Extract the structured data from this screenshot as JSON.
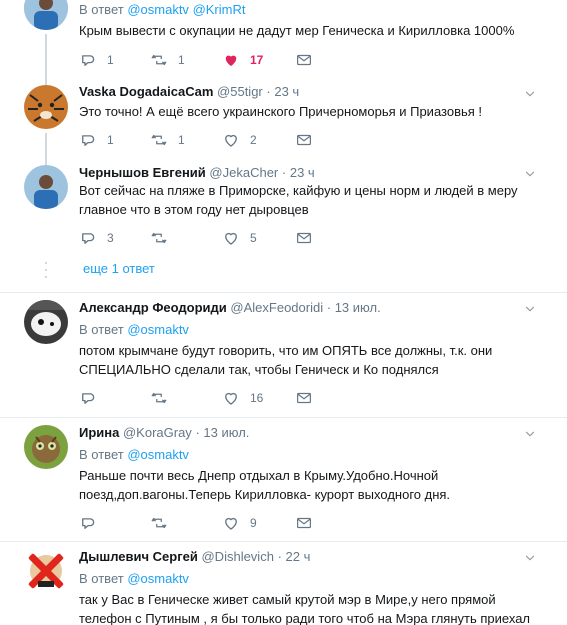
{
  "tweets": [
    {
      "reply_prefix": "В ответ",
      "mentions": [
        "@osmaktv",
        "@KrimRt"
      ],
      "text": "Крым вывести с окупации не дадут мер Геническа и Кирилловка 1000%",
      "replies": "1",
      "retweets": "1",
      "likes": "17",
      "liked": true
    },
    {
      "name": "Vaska DogadaicaCam",
      "handle": "@55tigr",
      "time": "23 ч",
      "text": "Это точно! А ещё всего украинского Причерноморья и Приазовья !",
      "replies": "1",
      "retweets": "1",
      "likes": "2"
    },
    {
      "name": "Чернышов Евгений",
      "handle": "@JekaCher",
      "time": "23 ч",
      "text_line1": "Вот сейчас на пляже в Приморске, кайфую и цены норм и людей в меру",
      "text_line2": "главное что в этом году нет дыровцев",
      "replies": "3",
      "retweets": "",
      "likes": "5"
    },
    {
      "more_replies": "еще 1 ответ"
    },
    {
      "name": "Александр Феодориди",
      "handle": "@AlexFeodoridi",
      "time": "13 июл.",
      "reply_prefix": "В ответ",
      "mention": "@osmaktv",
      "text_line1": "потом крымчане будут говорить, что им ОПЯТЬ все должны, т.к. они",
      "text_line2": "СПЕЦИАЛЬНО сделали так, чтобы Геническ и Ко поднялся",
      "replies": "",
      "retweets": "",
      "likes": "16"
    },
    {
      "name": "Ирина",
      "handle": "@KoraGray",
      "time": "13 июл.",
      "reply_prefix": "В ответ",
      "mention": "@osmaktv",
      "text_line1": "Раньше почти весь Днепр отдыхал в Крыму.Удобно.Ночной",
      "text_line2": "поезд,доп.вагоны.Теперь Кирилловка- курорт выходного дня.",
      "replies": "",
      "retweets": "",
      "likes": "9"
    },
    {
      "name": "Дышлевич Сергей",
      "handle": "@Dishlevich",
      "time": "22 ч",
      "reply_prefix": "В ответ",
      "mention": "@osmaktv",
      "text_line1": "так у Вас в Геническе живет самый крутой мэр в Мире,у него прямой",
      "text_line2": "телефон с Путиным , я бы только ради того чтоб на Мэра глянуть приехал"
    }
  ],
  "separator_dot": "·",
  "colors": {
    "accent": "#1da1f2",
    "like": "#e0245e",
    "muted": "#657786",
    "divider": "#e6ecf0"
  },
  "icons": [
    "reply-icon",
    "retweet-icon",
    "heart-icon",
    "mail-icon",
    "chevron-down-icon"
  ]
}
